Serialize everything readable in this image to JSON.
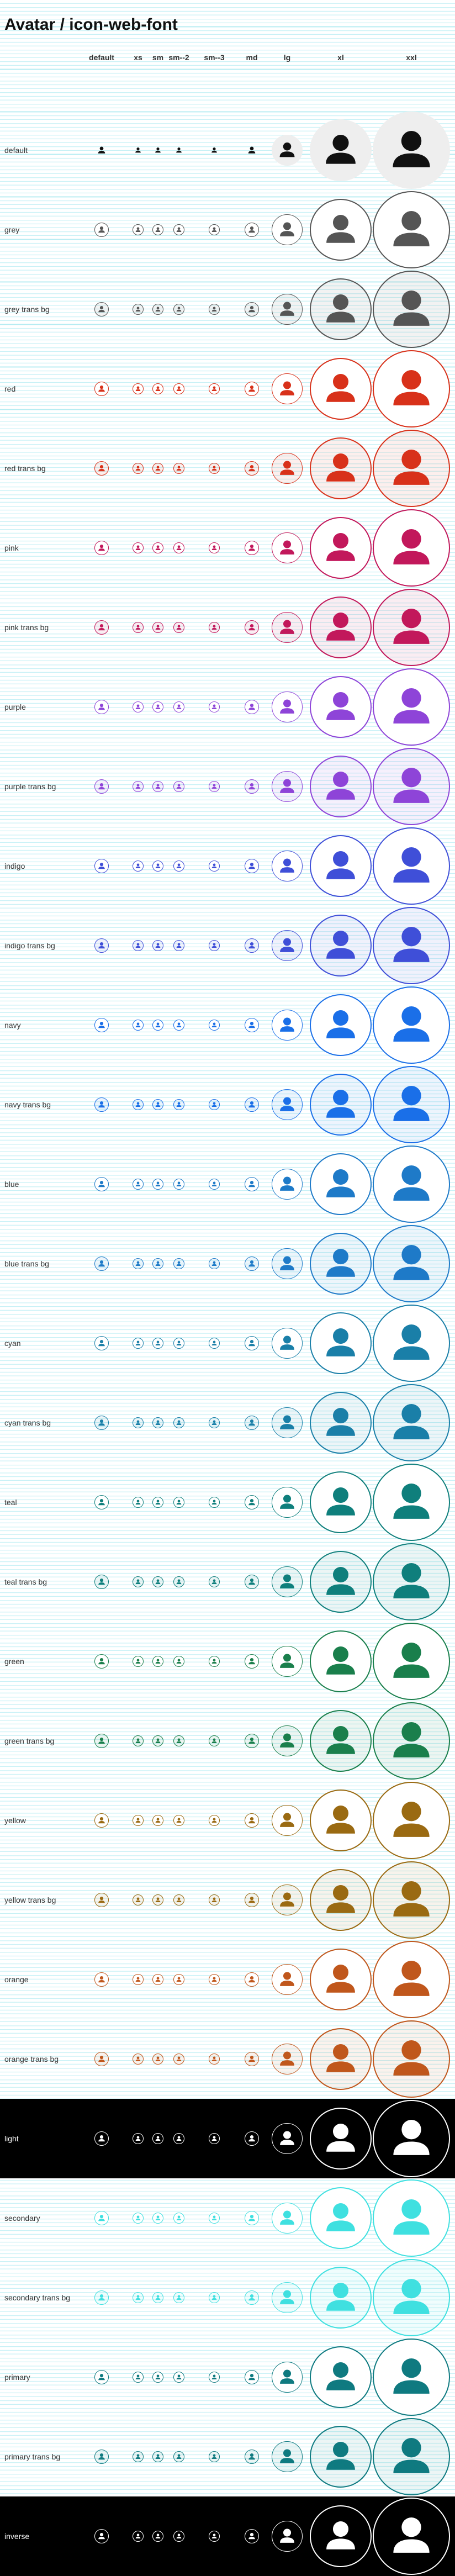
{
  "title": "Avatar / icon-web-font",
  "columns": [
    {
      "key": "default",
      "label": "default"
    },
    {
      "key": "xs",
      "label": "xs"
    },
    {
      "key": "sm",
      "label": "sm"
    },
    {
      "key": "sm2",
      "label": "sm--2"
    },
    {
      "key": "sm3",
      "label": "sm--3"
    },
    {
      "key": "md",
      "label": "md"
    },
    {
      "key": "lg",
      "label": "lg"
    },
    {
      "key": "xl",
      "label": "xl"
    },
    {
      "key": "xxl",
      "label": "xxl"
    }
  ],
  "rows": [
    {
      "label": "default",
      "variant": "default",
      "color": "#111111"
    },
    {
      "label": "grey",
      "variant": "ring",
      "color": "#555555"
    },
    {
      "label": "grey trans bg",
      "variant": "trans",
      "color": "#555555"
    },
    {
      "label": "red",
      "variant": "ring",
      "color": "#d8311a"
    },
    {
      "label": "red trans bg",
      "variant": "trans",
      "color": "#d8311a"
    },
    {
      "label": "pink",
      "variant": "ring",
      "color": "#c2185b"
    },
    {
      "label": "pink trans bg",
      "variant": "trans",
      "color": "#c2185b"
    },
    {
      "label": "purple",
      "variant": "ring",
      "color": "#8e44d8"
    },
    {
      "label": "purple trans bg",
      "variant": "trans",
      "color": "#8e44d8"
    },
    {
      "label": "indigo",
      "variant": "ring",
      "color": "#3f4fd8"
    },
    {
      "label": "indigo trans bg",
      "variant": "trans",
      "color": "#3f4fd8"
    },
    {
      "label": "navy",
      "variant": "ring",
      "color": "#1a6fe8"
    },
    {
      "label": "navy trans bg",
      "variant": "trans",
      "color": "#1a6fe8"
    },
    {
      "label": "blue",
      "variant": "ring",
      "color": "#1e7ac8"
    },
    {
      "label": "blue trans bg",
      "variant": "trans",
      "color": "#1e7ac8"
    },
    {
      "label": "cyan",
      "variant": "ring",
      "color": "#1a7fa8"
    },
    {
      "label": "cyan trans bg",
      "variant": "trans",
      "color": "#1a7fa8"
    },
    {
      "label": "teal",
      "variant": "ring",
      "color": "#0f7f7c"
    },
    {
      "label": "teal trans bg",
      "variant": "trans",
      "color": "#0f7f7c"
    },
    {
      "label": "green",
      "variant": "ring",
      "color": "#1a7f4c"
    },
    {
      "label": "green trans bg",
      "variant": "trans",
      "color": "#1a7f4c"
    },
    {
      "label": "yellow",
      "variant": "ring",
      "color": "#9a6a12"
    },
    {
      "label": "yellow trans bg",
      "variant": "trans",
      "color": "#9a6a12"
    },
    {
      "label": "orange",
      "variant": "ring",
      "color": "#c0571c"
    },
    {
      "label": "orange trans bg",
      "variant": "trans",
      "color": "#c0571c"
    },
    {
      "label": "light",
      "variant": "light",
      "color": "#ffffff"
    },
    {
      "label": "secondary",
      "variant": "ring",
      "color": "#3fe0e0"
    },
    {
      "label": "secondary trans bg",
      "variant": "trans",
      "color": "#3fe0e0"
    },
    {
      "label": "primary",
      "variant": "ring",
      "color": "#0f7a80"
    },
    {
      "label": "primary trans bg",
      "variant": "trans",
      "color": "#0f7a80"
    },
    {
      "label": "inverse",
      "variant": "inverse",
      "color": "#ffffff"
    }
  ],
  "icon": "user-icon",
  "colors": {
    "grid_line": "#b5ecf2",
    "default_bg": "#eeeeee",
    "dark_row_bg": "#000000"
  }
}
